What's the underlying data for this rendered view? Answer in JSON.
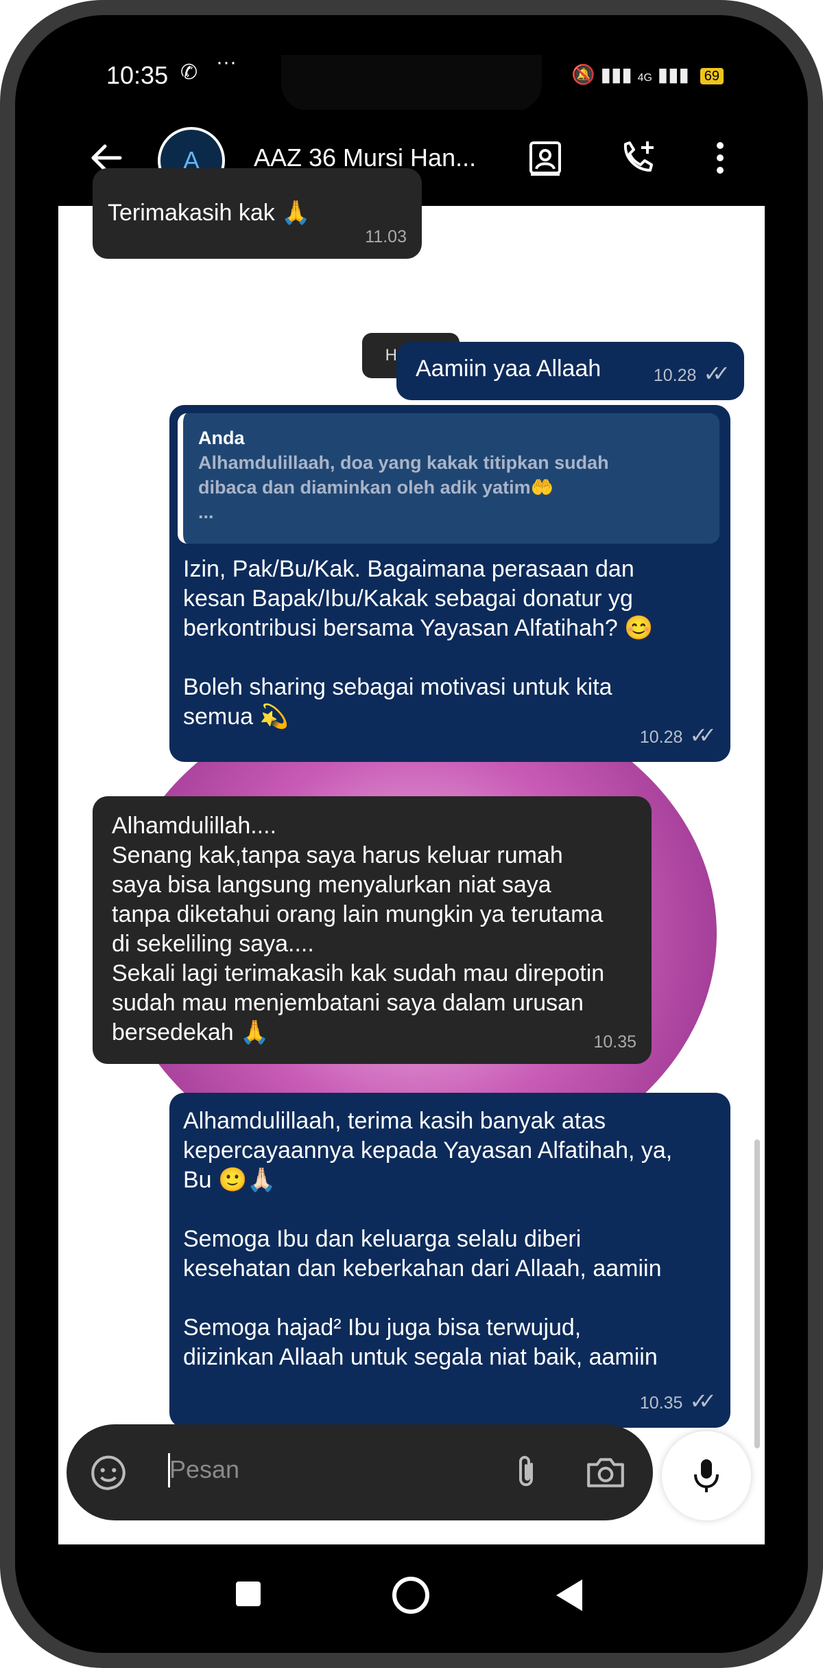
{
  "status_bar": {
    "time": "10:35",
    "dots": "···",
    "network": "4G",
    "battery": "69"
  },
  "header": {
    "avatar_letter": "A",
    "title": "AAZ 36 Mursi Han..."
  },
  "messages": {
    "prev_incoming": {
      "text": "Terimakasih kak 🙏",
      "time": "11.03"
    },
    "day_chip": "Hari ini",
    "out1": {
      "text": "Aamiin yaa Allaah",
      "time": "10.28"
    },
    "out2": {
      "quote_author": "Anda",
      "quote_text": "Alhamdulillaah, doa yang kakak titipkan sudah\ndibaca dan diaminkan oleh adik yatim🤲\n...",
      "text": "Izin, Pak/Bu/Kak. Bagaimana perasaan dan\nkesan Bapak/Ibu/Kakak sebagai donatur yg\nberkontribusi bersama Yayasan Alfatihah? 😊\n\nBoleh sharing sebagai motivasi untuk kita\nsemua 💫",
      "time": "10.28"
    },
    "in1": {
      "text": "Alhamdulillah....\nSenang kak,tanpa saya harus keluar rumah\nsaya bisa langsung menyalurkan niat saya\ntanpa diketahui orang lain mungkin ya terutama\ndi sekeliling saya....\nSekali lagi terimakasih kak sudah mau direpotin\nsudah mau menjembatani saya dalam urusan\nbersedekah 🙏",
      "time": "10.35"
    },
    "out3": {
      "text": "Alhamdulillaah, terima kasih banyak atas\nkepercayaannya kepada Yayasan Alfatihah, ya,\nBu 🙂🙏🏻\n\nSemoga Ibu dan keluarga selalu diberi\nkesehatan dan keberkahan dari Allaah, aamiin\n\nSemoga hajad² Ibu juga bisa terwujud,\ndiizinkan Allaah untuk segala niat baik, aamiin",
      "time": "10.35"
    }
  },
  "input": {
    "placeholder": "Pesan"
  },
  "icons": {
    "back": "arrow-left-icon",
    "contact": "contact-card-icon",
    "call": "add-call-icon",
    "menu": "more-vert-icon",
    "sticker": "sticker-icon",
    "attach": "paperclip-icon",
    "camera": "camera-icon",
    "mic": "mic-icon",
    "nav_recent": "square-icon",
    "nav_home": "circle-icon",
    "nav_back": "triangle-back-icon"
  },
  "colors": {
    "outgoing": "#0d2b5a",
    "incoming": "#262626",
    "quote": "#1f4672",
    "wallpaper": "#c85bb6"
  }
}
